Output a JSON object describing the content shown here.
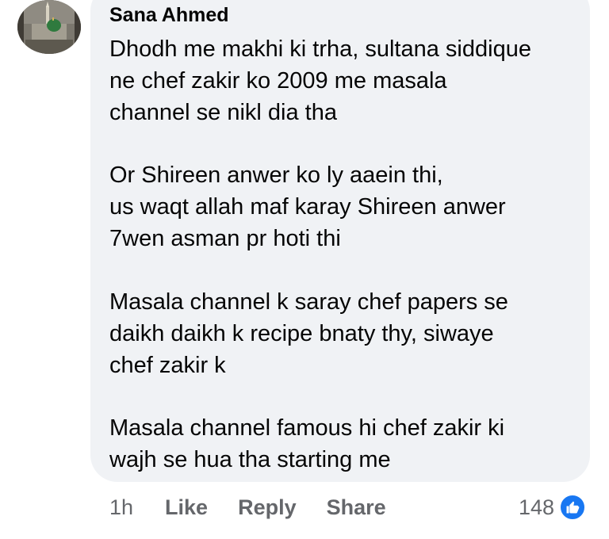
{
  "comment": {
    "author": "Sana Ahmed",
    "paragraphs": [
      {
        "lines": [
          "Dhodh me makhi ki trha, sultana siddique",
          "ne chef zakir ko 2009 me masala",
          "channel se nikl dia tha"
        ]
      },
      {
        "lines": [
          "Or Shireen anwer ko ly aaein thi,",
          "us waqt allah maf karay Shireen anwer",
          "7wen asman pr hoti thi"
        ]
      },
      {
        "lines": [
          "Masala channel k saray chef papers se",
          "daikh daikh k recipe bnaty thy, siwaye",
          "chef zakir k"
        ]
      },
      {
        "lines": [
          "Masala channel famous hi chef zakir ki",
          "wajh se hua tha starting me"
        ]
      }
    ],
    "timestamp": "1h",
    "actions": {
      "like": "Like",
      "reply": "Reply",
      "share": "Share"
    },
    "reactions": {
      "count": "148",
      "icon": "thumbs-up-icon",
      "color": "#1877f2"
    }
  }
}
